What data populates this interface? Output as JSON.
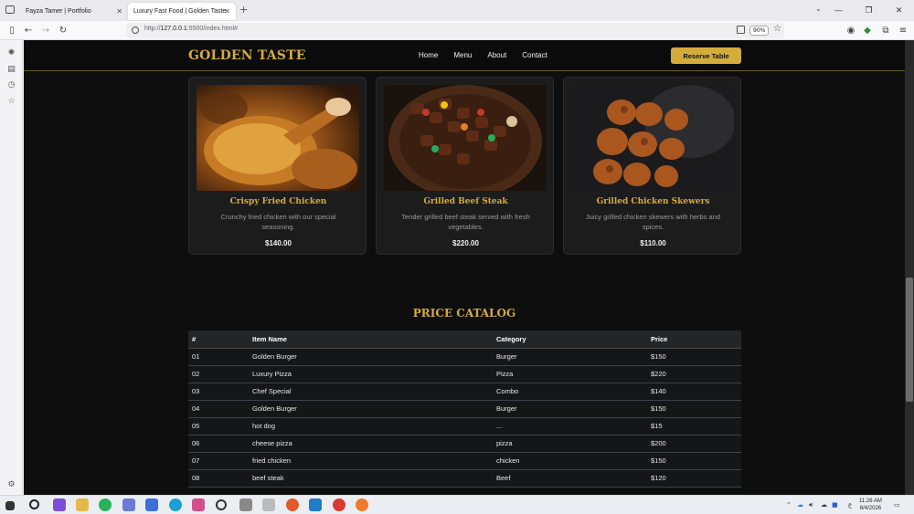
{
  "browser": {
    "tabs": [
      {
        "title": "Fayza Tamer | Portfolio"
      },
      {
        "title": "Luxury Fast Food | Golden Taste"
      }
    ],
    "url_prefix": "http://",
    "url_host": "127.0.0.1",
    "url_rest": ":5500/index.html#",
    "zoom": "90%"
  },
  "site": {
    "logo": "GOLDEN TASTE",
    "menu": [
      "Home",
      "Menu",
      "About",
      "Contact"
    ],
    "reserve_label": "Reserve Table"
  },
  "cards": [
    {
      "title": "Crispy Fried Chicken",
      "desc": "Crunchy fried chicken with our special seasoning.",
      "price": "$140.00"
    },
    {
      "title": "Grilled Beef Steak",
      "desc": "Tender grilled beef steak served with fresh vegetables.",
      "price": "$220.00"
    },
    {
      "title": "Grilled Chicken Skewers",
      "desc": "Juicy grilled chicken skewers with herbs and spices.",
      "price": "$110.00"
    }
  ],
  "catalog": {
    "title": "PRICE CATALOG",
    "headers": [
      "#",
      "Item Name",
      "Category",
      "Price"
    ],
    "rows": [
      [
        "01",
        "Golden Burger",
        "Burger",
        "$150"
      ],
      [
        "02",
        "Luxury Pizza",
        "Pizza",
        "$220"
      ],
      [
        "03",
        "Chef Special",
        "Combo",
        "$140"
      ],
      [
        "04",
        "Golden Burger",
        "Burger",
        "$150"
      ],
      [
        "05",
        "hot dog",
        "...",
        "$15"
      ],
      [
        "06",
        "cheese pizza",
        "pizza",
        "$200"
      ],
      [
        "07",
        "fried chicken",
        "chicken",
        "$150"
      ],
      [
        "08",
        "beef steak",
        "Beef",
        "$120"
      ]
    ]
  },
  "taskbar": {
    "time": "11:26 AM",
    "date": "8/4/2026"
  },
  "colors": {
    "gold": "#d4ac3b",
    "page_bg": "#0e0e0e",
    "card_bg": "#1c1c1c"
  }
}
